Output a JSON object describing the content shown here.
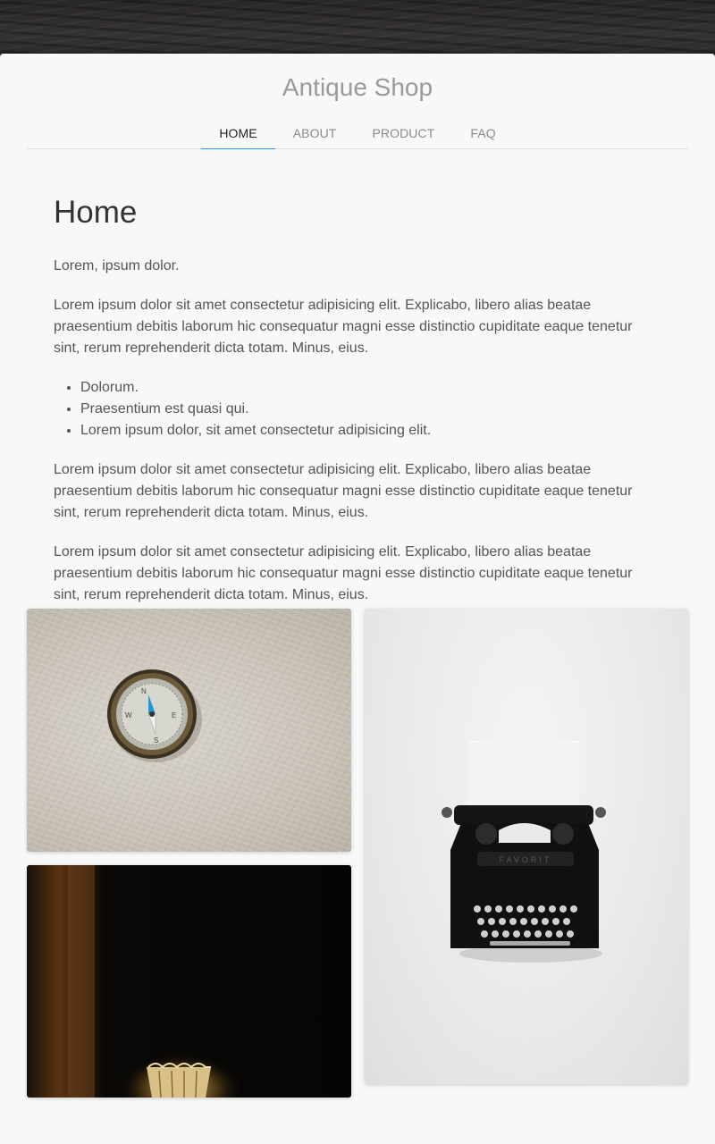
{
  "site": {
    "title": "Antique Shop"
  },
  "nav": {
    "tabs": [
      {
        "label": "HOME",
        "active": true
      },
      {
        "label": "ABOUT",
        "active": false
      },
      {
        "label": "PRODUCT",
        "active": false
      },
      {
        "label": "FAQ",
        "active": false
      }
    ]
  },
  "main": {
    "heading": "Home",
    "intro": "Lorem, ipsum dolor.",
    "paragraph_1": "Lorem ipsum dolor sit amet consectetur adipisicing elit. Explicabo, libero alias beatae praesentium debitis laborum hic consequatur magni esse distinctio cupiditate eaque tenetur sint, rerum reprehenderit dicta totam. Minus, eius.",
    "list": [
      "Dolorum.",
      "Praesentium est quasi qui.",
      "Lorem ipsum dolor, sit amet consectetur adipisicing elit."
    ],
    "paragraph_2": "Lorem ipsum dolor sit amet consectetur adipisicing elit. Explicabo, libero alias beatae praesentium debitis laborum hic consequatur magni esse distinctio cupiditate eaque tenetur sint, rerum reprehenderit dicta totam. Minus, eius.",
    "paragraph_3": "Lorem ipsum dolor sit amet consectetur adipisicing elit. Explicabo, libero alias beatae praesentium debitis laborum hic consequatur magni esse distinctio cupiditate eaque tenetur sint, rerum reprehenderit dicta totam. Minus, eius."
  },
  "gallery": {
    "images": [
      "compass-photo",
      "typewriter-photo",
      "lamp-photo"
    ]
  },
  "colors": {
    "accent": "#2196f3",
    "title": "#9a9a9a",
    "page_background": "#f8f8f8"
  }
}
